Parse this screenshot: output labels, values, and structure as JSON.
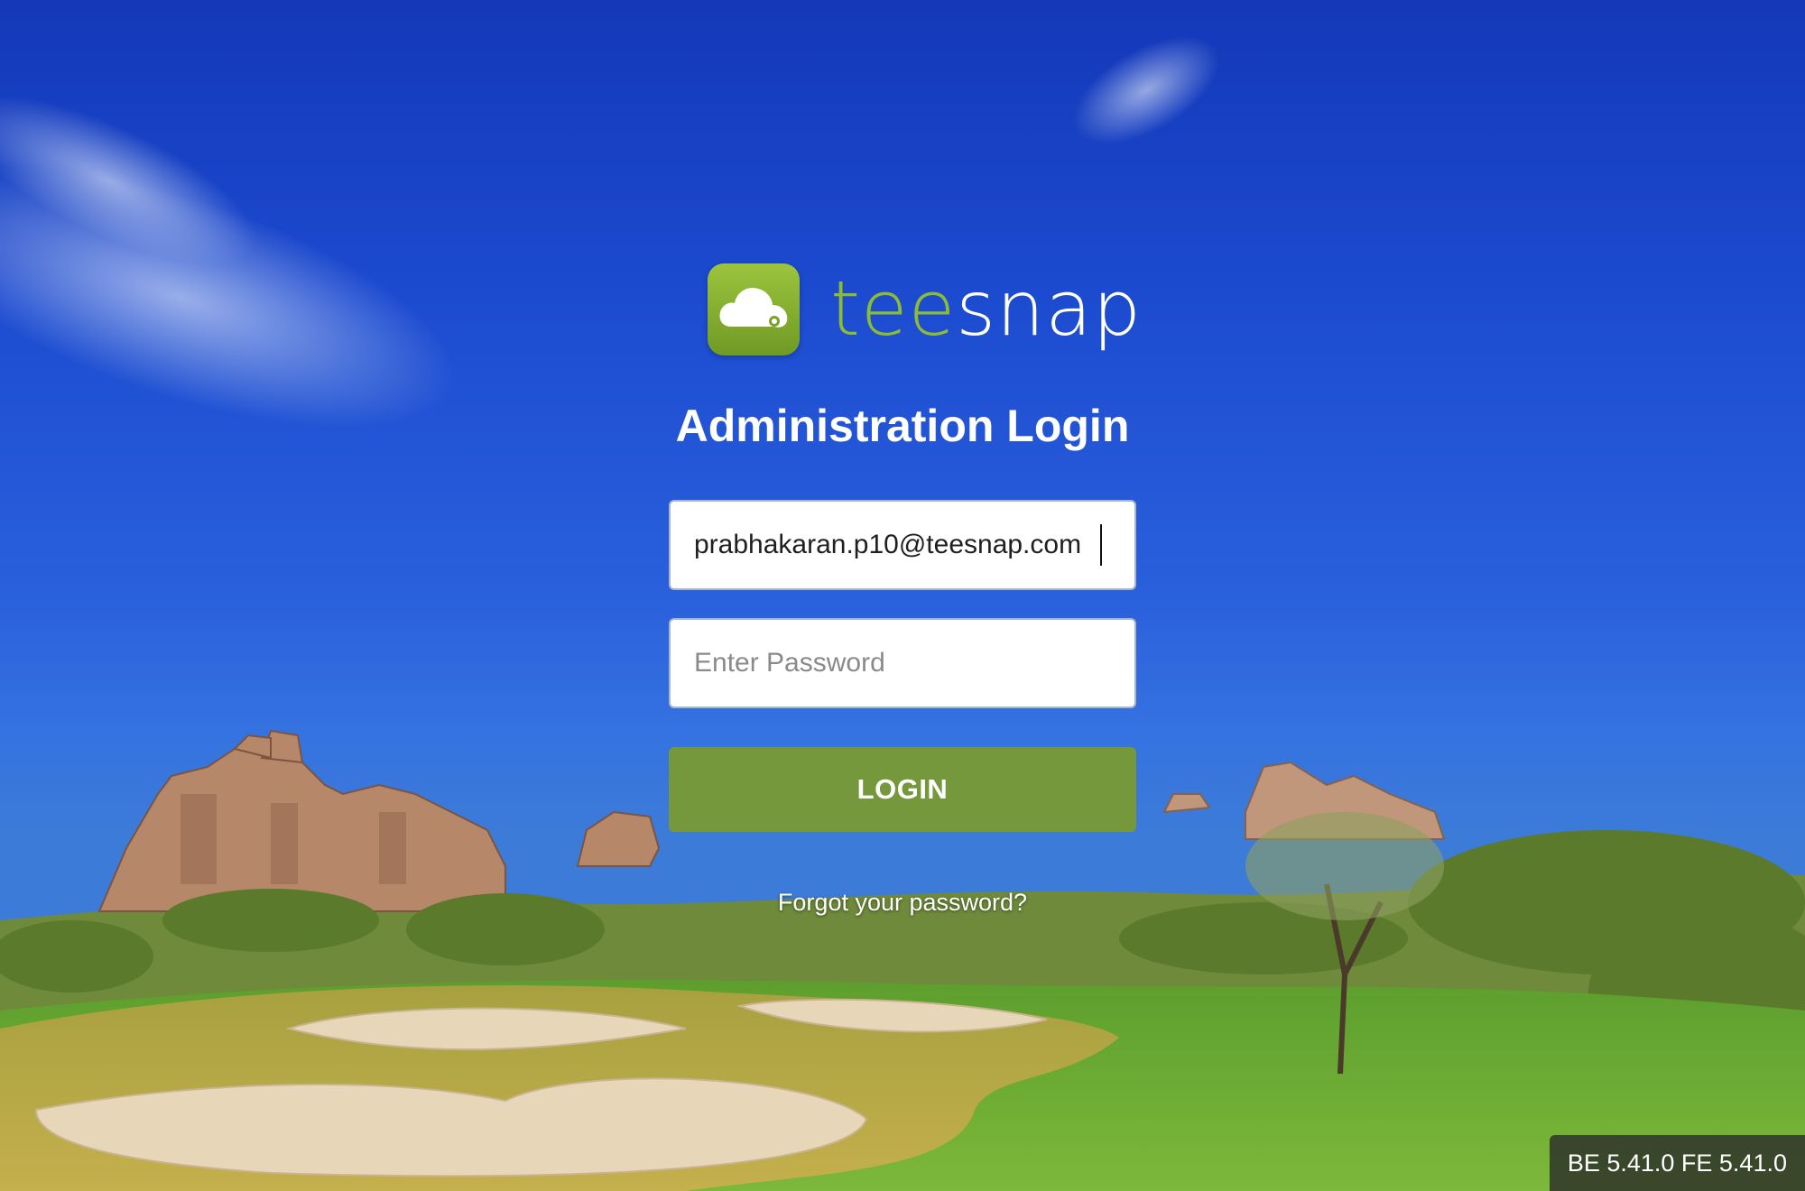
{
  "brand": {
    "wordmark_tee": "tee",
    "wordmark_snap": "snap",
    "logo_icon": "cloud-icon"
  },
  "login": {
    "title": "Administration Login",
    "email_value": "prabhakaran.p10@teesnap.com",
    "password_placeholder": "Enter Password",
    "login_button": "LOGIN",
    "forgot_link": "Forgot your password?"
  },
  "footer": {
    "version": "BE 5.41.0 FE 5.41.0"
  },
  "colors": {
    "accent_green": "#76983c",
    "wordmark_green": "#8cbc34",
    "sky_blue": "#1c4bd0"
  }
}
